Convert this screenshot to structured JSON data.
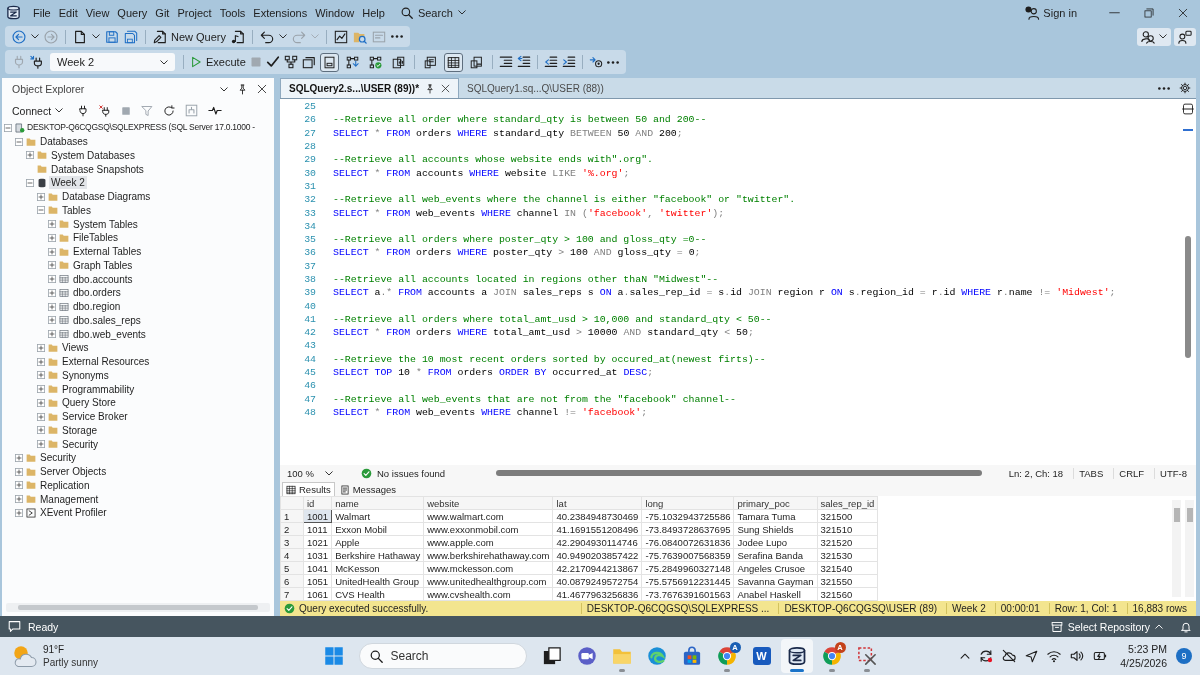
{
  "menu_bar": {
    "items": [
      "File",
      "Edit",
      "View",
      "Query",
      "Git",
      "Project",
      "Tools",
      "Extensions",
      "Window",
      "Help"
    ],
    "search": "Search",
    "sign_in": "Sign in"
  },
  "standard_toolbar": {
    "new_query": "New Query"
  },
  "query_toolbar": {
    "database": "Week 2",
    "execute": "Execute",
    "toggles": [
      {
        "on": true
      },
      {
        "on": false
      },
      {
        "on": false
      },
      {
        "on": false
      }
    ],
    "result_modes": [
      {
        "selected": false
      },
      {
        "selected": true
      },
      {
        "selected": false
      }
    ]
  },
  "object_explorer": {
    "title": "Object Explorer",
    "connect": "Connect",
    "tree": [
      {
        "label": "DESKTOP-Q6CQGSQ\\SQLEXPRESS (SQL Server 17.0.1000 -",
        "kind": "server",
        "expanded": true,
        "selected": false,
        "children": [
          {
            "label": "Databases",
            "kind": "folder",
            "expanded": true,
            "selected": false,
            "children": [
              {
                "label": "System Databases",
                "kind": "folder",
                "expanded": false,
                "selected": false
              },
              {
                "label": "Database Snapshots",
                "kind": "folder",
                "selected": false
              },
              {
                "label": "Week 2",
                "kind": "database",
                "expanded": true,
                "selected": true,
                "children": [
                  {
                    "label": "Database Diagrams",
                    "kind": "folder",
                    "expanded": false,
                    "selected": false
                  },
                  {
                    "label": "Tables",
                    "kind": "folder",
                    "expanded": true,
                    "selected": false,
                    "children": [
                      {
                        "label": "System Tables",
                        "kind": "folder",
                        "expanded": false,
                        "selected": false
                      },
                      {
                        "label": "FileTables",
                        "kind": "folder",
                        "expanded": false,
                        "selected": false
                      },
                      {
                        "label": "External Tables",
                        "kind": "folder",
                        "expanded": false,
                        "selected": false
                      },
                      {
                        "label": "Graph Tables",
                        "kind": "folder",
                        "expanded": false,
                        "selected": false
                      },
                      {
                        "label": "dbo.accounts",
                        "kind": "table",
                        "expanded": false,
                        "selected": false
                      },
                      {
                        "label": "dbo.orders",
                        "kind": "table",
                        "expanded": false,
                        "selected": false
                      },
                      {
                        "label": "dbo.region",
                        "kind": "table",
                        "expanded": false,
                        "selected": false
                      },
                      {
                        "label": "dbo.sales_reps",
                        "kind": "table",
                        "expanded": false,
                        "selected": false
                      },
                      {
                        "label": "dbo.web_events",
                        "kind": "table",
                        "expanded": false,
                        "selected": false
                      }
                    ]
                  },
                  {
                    "label": "Views",
                    "kind": "folder",
                    "expanded": false,
                    "selected": false
                  },
                  {
                    "label": "External Resources",
                    "kind": "folder",
                    "expanded": false,
                    "selected": false
                  },
                  {
                    "label": "Synonyms",
                    "kind": "folder",
                    "expanded": false,
                    "selected": false
                  },
                  {
                    "label": "Programmability",
                    "kind": "folder",
                    "expanded": false,
                    "selected": false
                  },
                  {
                    "label": "Query Store",
                    "kind": "folder",
                    "expanded": false,
                    "selected": false
                  },
                  {
                    "label": "Service Broker",
                    "kind": "folder",
                    "expanded": false,
                    "selected": false
                  },
                  {
                    "label": "Storage",
                    "kind": "folder",
                    "expanded": false,
                    "selected": false
                  },
                  {
                    "label": "Security",
                    "kind": "folder",
                    "expanded": false,
                    "selected": false
                  }
                ]
              }
            ]
          },
          {
            "label": "Security",
            "kind": "folder",
            "expanded": false,
            "selected": false
          },
          {
            "label": "Server Objects",
            "kind": "folder",
            "expanded": false,
            "selected": false
          },
          {
            "label": "Replication",
            "kind": "folder",
            "expanded": false,
            "selected": false
          },
          {
            "label": "Management",
            "kind": "folder",
            "expanded": false,
            "selected": false
          },
          {
            "label": "XEvent Profiler",
            "kind": "profiler",
            "expanded": false,
            "selected": false
          }
        ]
      }
    ]
  },
  "editor": {
    "tabs": [
      {
        "label": "SQLQuery2.s...\\USER (89))*",
        "selected": true
      },
      {
        "label": "SQLQuery1.sq...Q\\USER (88))",
        "selected": false
      }
    ],
    "lines": [
      {
        "number": "25"
      },
      {
        "number": "26",
        "tokens": [
          {
            "kind": "comment",
            "text": "--Retrieve all order where standard_qty is between 50 and 200--"
          }
        ]
      },
      {
        "number": "27",
        "tokens": [
          {
            "kind": "keyword",
            "text": "SELECT "
          },
          {
            "kind": "operator",
            "text": "*"
          },
          {
            "kind": "keyword",
            "text": " FROM "
          },
          {
            "kind": "plain",
            "text": "orders "
          },
          {
            "kind": "keyword",
            "text": "WHERE "
          },
          {
            "kind": "plain",
            "text": "standard_qty "
          },
          {
            "kind": "operator",
            "text": "BETWEEN "
          },
          {
            "kind": "plain",
            "text": "50 "
          },
          {
            "kind": "operator",
            "text": "AND "
          },
          {
            "kind": "plain",
            "text": "200"
          },
          {
            "kind": "operator",
            "text": ";"
          }
        ]
      },
      {
        "number": "28"
      },
      {
        "number": "29",
        "tokens": [
          {
            "kind": "comment",
            "text": "--Retrieve all accounts whose website ends with\".org\"."
          }
        ]
      },
      {
        "number": "30",
        "tokens": [
          {
            "kind": "keyword",
            "text": "SELECT "
          },
          {
            "kind": "operator",
            "text": "*"
          },
          {
            "kind": "keyword",
            "text": " FROM "
          },
          {
            "kind": "plain",
            "text": "accounts "
          },
          {
            "kind": "keyword",
            "text": "WHERE "
          },
          {
            "kind": "plain",
            "text": "website "
          },
          {
            "kind": "operator",
            "text": "LIKE "
          },
          {
            "kind": "string",
            "text": "'%.org'"
          },
          {
            "kind": "operator",
            "text": ";"
          }
        ]
      },
      {
        "number": "31"
      },
      {
        "number": "32",
        "tokens": [
          {
            "kind": "comment",
            "text": "--Retrieve all web_events where the channel is either \"facebook\" or \"twitter\"."
          }
        ]
      },
      {
        "number": "33",
        "tokens": [
          {
            "kind": "keyword",
            "text": "SELECT "
          },
          {
            "kind": "operator",
            "text": "*"
          },
          {
            "kind": "keyword",
            "text": " FROM "
          },
          {
            "kind": "plain",
            "text": "web_events "
          },
          {
            "kind": "keyword",
            "text": "WHERE "
          },
          {
            "kind": "plain",
            "text": "channel "
          },
          {
            "kind": "operator",
            "text": "IN "
          },
          {
            "kind": "operator",
            "text": "("
          },
          {
            "kind": "string",
            "text": "'facebook'"
          },
          {
            "kind": "operator",
            "text": ", "
          },
          {
            "kind": "string",
            "text": "'twitter'"
          },
          {
            "kind": "operator",
            "text": ");"
          }
        ]
      },
      {
        "number": "34"
      },
      {
        "number": "35",
        "tokens": [
          {
            "kind": "comment",
            "text": "--Retrieve all orders where poster_qty > 100 and gloss_qty =0--"
          }
        ]
      },
      {
        "number": "36",
        "tokens": [
          {
            "kind": "keyword",
            "text": "SELECT "
          },
          {
            "kind": "operator",
            "text": "*"
          },
          {
            "kind": "keyword",
            "text": " FROM "
          },
          {
            "kind": "plain",
            "text": "orders "
          },
          {
            "kind": "keyword",
            "text": "WHERE "
          },
          {
            "kind": "plain",
            "text": "poster_qty "
          },
          {
            "kind": "operator",
            "text": "> "
          },
          {
            "kind": "plain",
            "text": "100 "
          },
          {
            "kind": "operator",
            "text": "AND "
          },
          {
            "kind": "plain",
            "text": "gloss_qty "
          },
          {
            "kind": "operator",
            "text": "= "
          },
          {
            "kind": "plain",
            "text": "0"
          },
          {
            "kind": "operator",
            "text": ";"
          }
        ]
      },
      {
        "number": "37"
      },
      {
        "number": "38",
        "tokens": [
          {
            "kind": "comment",
            "text": "--Retrieve all accounts located in regions other thaN \"Midwest\"--"
          }
        ]
      },
      {
        "number": "39",
        "tokens": [
          {
            "kind": "keyword",
            "text": "SELECT "
          },
          {
            "kind": "plain",
            "text": "a"
          },
          {
            "kind": "operator",
            "text": ".*"
          },
          {
            "kind": "keyword",
            "text": " FROM "
          },
          {
            "kind": "plain",
            "text": "accounts a "
          },
          {
            "kind": "operator",
            "text": "JOIN "
          },
          {
            "kind": "plain",
            "text": "sales_reps s "
          },
          {
            "kind": "keyword",
            "text": "ON "
          },
          {
            "kind": "plain",
            "text": "a"
          },
          {
            "kind": "operator",
            "text": "."
          },
          {
            "kind": "plain",
            "text": "sales_rep_id "
          },
          {
            "kind": "operator",
            "text": "= "
          },
          {
            "kind": "plain",
            "text": "s"
          },
          {
            "kind": "operator",
            "text": "."
          },
          {
            "kind": "plain",
            "text": "id "
          },
          {
            "kind": "operator",
            "text": "JOIN "
          },
          {
            "kind": "plain",
            "text": "region r "
          },
          {
            "kind": "keyword",
            "text": "ON "
          },
          {
            "kind": "plain",
            "text": "s"
          },
          {
            "kind": "operator",
            "text": "."
          },
          {
            "kind": "plain",
            "text": "region_id "
          },
          {
            "kind": "operator",
            "text": "= "
          },
          {
            "kind": "plain",
            "text": "r"
          },
          {
            "kind": "operator",
            "text": "."
          },
          {
            "kind": "plain",
            "text": "id "
          },
          {
            "kind": "keyword",
            "text": "WHERE "
          },
          {
            "kind": "plain",
            "text": "r"
          },
          {
            "kind": "operator",
            "text": "."
          },
          {
            "kind": "plain",
            "text": "name "
          },
          {
            "kind": "operator",
            "text": "!= "
          },
          {
            "kind": "string",
            "text": "'Midwest'"
          },
          {
            "kind": "operator",
            "text": ";"
          }
        ]
      },
      {
        "number": "40"
      },
      {
        "number": "41",
        "tokens": [
          {
            "kind": "comment",
            "text": "--Retrieve all orders where total_amt_usd > 10,000 and standard_qty < 50--"
          }
        ]
      },
      {
        "number": "42",
        "tokens": [
          {
            "kind": "keyword",
            "text": "SELECT "
          },
          {
            "kind": "operator",
            "text": "*"
          },
          {
            "kind": "keyword",
            "text": " FROM "
          },
          {
            "kind": "plain",
            "text": "orders "
          },
          {
            "kind": "keyword",
            "text": "WHERE "
          },
          {
            "kind": "plain",
            "text": "total_amt_usd "
          },
          {
            "kind": "operator",
            "text": "> "
          },
          {
            "kind": "plain",
            "text": "10000 "
          },
          {
            "kind": "operator",
            "text": "AND "
          },
          {
            "kind": "plain",
            "text": "standard_qty "
          },
          {
            "kind": "operator",
            "text": "< "
          },
          {
            "kind": "plain",
            "text": "50"
          },
          {
            "kind": "operator",
            "text": ";"
          }
        ]
      },
      {
        "number": "43"
      },
      {
        "number": "44",
        "tokens": [
          {
            "kind": "comment",
            "text": "--Retrieve the 10 most recent orders sorted by occured_at(newest firts)--"
          }
        ]
      },
      {
        "number": "45",
        "tokens": [
          {
            "kind": "keyword",
            "text": "SELECT TOP "
          },
          {
            "kind": "plain",
            "text": "10 "
          },
          {
            "kind": "operator",
            "text": "* "
          },
          {
            "kind": "keyword",
            "text": "FROM "
          },
          {
            "kind": "plain",
            "text": "orders "
          },
          {
            "kind": "keyword",
            "text": "ORDER BY "
          },
          {
            "kind": "plain",
            "text": "occurred_at "
          },
          {
            "kind": "keyword",
            "text": "DESC"
          },
          {
            "kind": "operator",
            "text": ";"
          }
        ]
      },
      {
        "number": "46"
      },
      {
        "number": "47",
        "tokens": [
          {
            "kind": "comment",
            "text": "--Retrieve all web_events that are not from the \"facebook\" channel--"
          }
        ]
      },
      {
        "number": "48",
        "tokens": [
          {
            "kind": "keyword",
            "text": "SELECT "
          },
          {
            "kind": "operator",
            "text": "*"
          },
          {
            "kind": "keyword",
            "text": " FROM "
          },
          {
            "kind": "plain",
            "text": "web_events "
          },
          {
            "kind": "keyword",
            "text": "WHERE "
          },
          {
            "kind": "plain",
            "text": "channel "
          },
          {
            "kind": "operator",
            "text": "!= "
          },
          {
            "kind": "string",
            "text": "'facebook'"
          },
          {
            "kind": "operator",
            "text": ";"
          }
        ]
      }
    ],
    "zoom": "100 %",
    "issues": "No issues found",
    "position": "Ln: 2, Ch: 18",
    "indent": "TABS",
    "line_ending": "CRLF",
    "encoding": "UTF-8"
  },
  "results": {
    "tabs": [
      {
        "label": "Results",
        "selected": true
      },
      {
        "label": "Messages",
        "selected": false
      }
    ],
    "columns": [
      "id",
      "name",
      "website",
      "lat",
      "long",
      "primary_poc",
      "sales_rep_id"
    ],
    "rows": [
      {
        "number": "1",
        "selected": true,
        "cells": [
          "1001",
          "Walmart",
          "www.walmart.com",
          "40.2384948730469",
          "-75.1032943725586",
          "Tamara Tuma",
          "321500"
        ]
      },
      {
        "number": "2",
        "selected": false,
        "cells": [
          "1011",
          "Exxon Mobil",
          "www.exxonmobil.com",
          "41.1691551208496",
          "-73.8493728637695",
          "Sung Shields",
          "321510"
        ]
      },
      {
        "number": "3",
        "selected": false,
        "cells": [
          "1021",
          "Apple",
          "www.apple.com",
          "42.2904930114746",
          "-76.0840072631836",
          "Jodee Lupo",
          "321520"
        ]
      },
      {
        "number": "4",
        "selected": false,
        "cells": [
          "1031",
          "Berkshire Hathaway",
          "www.berkshirehathaway.com",
          "40.9490203857422",
          "-75.7639007568359",
          "Serafina Banda",
          "321530"
        ]
      },
      {
        "number": "5",
        "selected": false,
        "cells": [
          "1041",
          "McKesson",
          "www.mckesson.com",
          "42.2170944213867",
          "-75.2849960327148",
          "Angeles Crusoe",
          "321540"
        ]
      },
      {
        "number": "6",
        "selected": false,
        "cells": [
          "1051",
          "UnitedHealth Group",
          "www.unitedhealthgroup.com",
          "40.0879249572754",
          "-75.5756912231445",
          "Savanna Gayman",
          "321550"
        ]
      },
      {
        "number": "7",
        "selected": false,
        "cells": [
          "1061",
          "CVS Health",
          "www.cvshealth.com",
          "41.4677963256836",
          "-73.7676391601563",
          "Anabel Haskell",
          "321560"
        ]
      }
    ]
  },
  "query_status": {
    "message": "Query executed successfully.",
    "server": "DESKTOP-Q6CQGSQ\\SQLEXPRESS ...",
    "user": "DESKTOP-Q6CQGSQ\\USER (89)",
    "database": "Week 2",
    "elapsed": "00:00:01",
    "cursor": "Row: 1, Col: 1",
    "rows": "16,883 rows"
  },
  "status_bar": {
    "text": "Ready",
    "repository": "Select Repository"
  },
  "taskbar": {
    "weather": {
      "temperature": "91°F",
      "condition": "Partly sunny"
    },
    "search": {
      "placeholder": "Search"
    },
    "apps": [
      {
        "kind": "task-view",
        "selected": false,
        "running": false
      },
      {
        "kind": "video-chat",
        "selected": false,
        "running": false
      },
      {
        "kind": "folder",
        "selected": false,
        "running": true
      },
      {
        "kind": "browser-wave",
        "selected": false,
        "running": false
      },
      {
        "kind": "store",
        "selected": false,
        "running": false
      },
      {
        "kind": "browser-ball",
        "selected": false,
        "running": true,
        "badge": {
          "text": "A",
          "color": "#1a5fb4"
        }
      },
      {
        "kind": "word",
        "glyph": "W",
        "selected": false,
        "running": false
      },
      {
        "kind": "database",
        "selected": true,
        "running": true
      },
      {
        "kind": "browser-ball",
        "selected": false,
        "running": true,
        "badge": {
          "text": "A",
          "color": "#c4421a"
        }
      },
      {
        "kind": "snipping",
        "selected": false,
        "running": true
      }
    ],
    "time": "5:23 PM",
    "date": "4/25/2026",
    "notifications": "9"
  }
}
